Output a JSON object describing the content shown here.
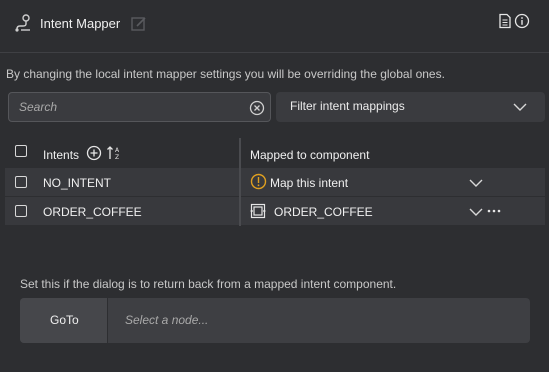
{
  "header": {
    "title": "Intent Mapper",
    "icons": [
      "intent-mapper-logo-icon",
      "edit-icon",
      "document-icon",
      "info-icon"
    ]
  },
  "description": "By changing the local intent mapper settings you will be overriding the global ones.",
  "search": {
    "placeholder": "Search"
  },
  "filter": {
    "label": "Filter intent mappings"
  },
  "table": {
    "headers": {
      "intents": "Intents",
      "mapped": "Mapped to component"
    },
    "rows": [
      {
        "intent": "NO_INTENT",
        "mapped": "Map this intent",
        "status": "warning"
      },
      {
        "intent": "ORDER_COFFEE",
        "mapped": "ORDER_COFFEE",
        "status": "mapped"
      }
    ]
  },
  "goto": {
    "hint": "Set this if the dialog is to return back from a mapped intent component.",
    "button_label": "GoTo",
    "placeholder": "Select a node..."
  },
  "colors": {
    "background": "#2d2e31",
    "warning": "#e0a020",
    "panel": "#3a3b3f"
  }
}
